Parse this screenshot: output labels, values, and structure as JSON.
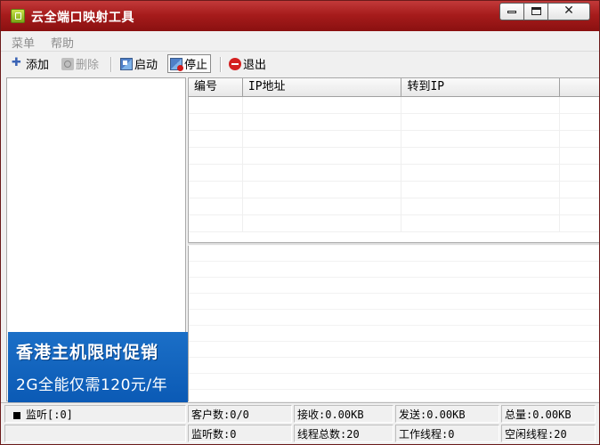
{
  "window": {
    "title": "云全端口映射工具",
    "controls": [
      "minimize",
      "maximize",
      "close"
    ]
  },
  "menu": {
    "items": [
      {
        "label": "菜单"
      },
      {
        "label": "帮助"
      }
    ]
  },
  "toolbar": {
    "add_label": "添加",
    "delete_label": "删除",
    "start_label": "启动",
    "stop_label": "停止",
    "exit_label": "退出"
  },
  "grid": {
    "columns": [
      "编号",
      "IP地址",
      "转到IP",
      ""
    ],
    "rows": []
  },
  "ad": {
    "line1": "香港主机限时促销",
    "line2": "2G全能仅需120元/年"
  },
  "statusbar": {
    "listen": "监听[:0]",
    "clients": "客户数:0/0",
    "received": "接收:0.00KB",
    "sent": "发送:0.00KB",
    "total": "总量:0.00KB",
    "listening": "监听数:0",
    "threads_total": "线程总数:20",
    "threads_working": "工作线程:0",
    "threads_idle": "空闲线程:20"
  },
  "colors": {
    "titlebar": "#a71c1c",
    "ad_background": "#0b5ab5",
    "exit_icon": "#d42020"
  },
  "icons": {
    "app": "app-icon",
    "add": "plus-icon",
    "delete": "delete-icon",
    "start": "start-icon",
    "stop": "stop-icon",
    "exit": "exit-icon"
  }
}
